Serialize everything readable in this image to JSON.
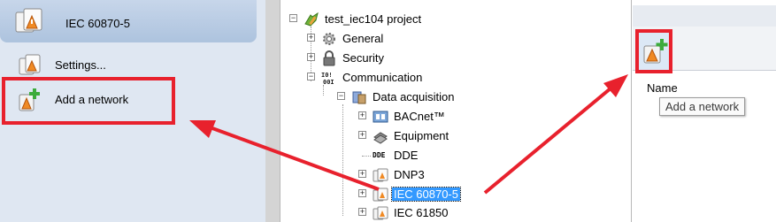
{
  "left_panel": {
    "title": "IEC 60870-5",
    "items": [
      {
        "label": "Settings..."
      },
      {
        "label": "Add a network"
      }
    ]
  },
  "tree": {
    "root": "test_iec104 project",
    "nodes": [
      {
        "label": "General",
        "expander": "+"
      },
      {
        "label": "Security",
        "expander": "+"
      },
      {
        "label": "Communication",
        "expander": "−"
      },
      {
        "label": "Data acquisition",
        "expander": "−"
      },
      {
        "label": "BACnet™",
        "expander": "+"
      },
      {
        "label": "Equipment",
        "expander": "+"
      },
      {
        "label": "DDE",
        "expander": ""
      },
      {
        "label": "DNP3",
        "expander": "+"
      },
      {
        "label": "IEC 60870-5",
        "expander": "+",
        "selected": true
      },
      {
        "label": "IEC 61850",
        "expander": "+"
      }
    ],
    "icon_badges": {
      "dde": "DDE"
    }
  },
  "right_panel": {
    "column_name": "Name",
    "tooltip": "Add a network"
  },
  "colors": {
    "highlight_red": "#e8212d",
    "selection_blue": "#3399ff"
  }
}
